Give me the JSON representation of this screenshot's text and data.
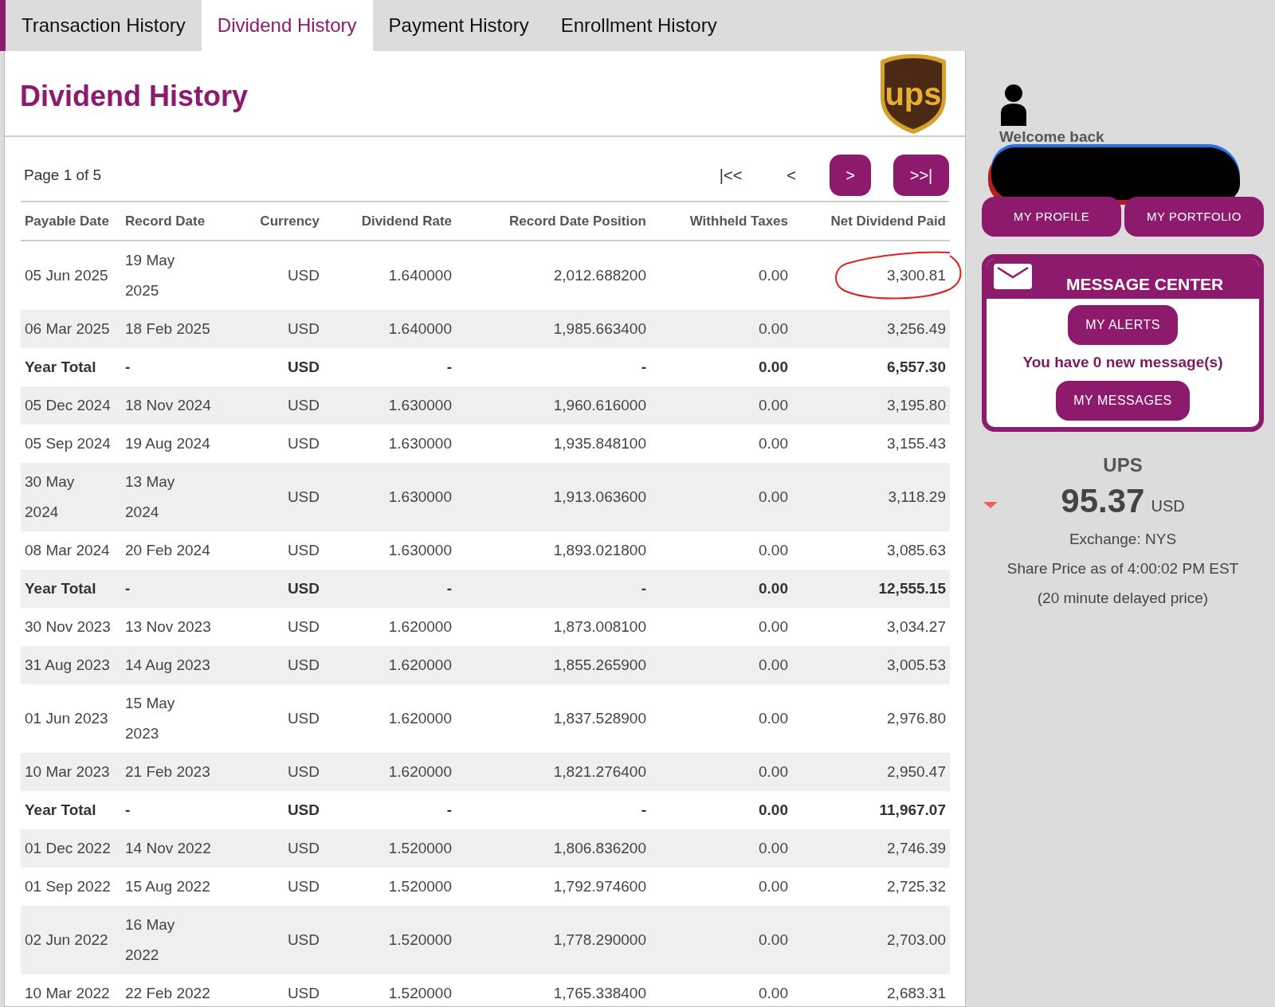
{
  "tabs": [
    {
      "label": "Transaction History",
      "selected": false
    },
    {
      "label": "Dividend History",
      "selected": true
    },
    {
      "label": "Payment History",
      "selected": false
    },
    {
      "label": "Enrollment History",
      "selected": false
    }
  ],
  "panel": {
    "title": "Dividend History",
    "logo_text": "ups"
  },
  "pager": {
    "page_text": "Page 1 of 5",
    "buttons": [
      {
        "label": "|<<",
        "disabled": true
      },
      {
        "label": "<",
        "disabled": true
      },
      {
        "label": ">",
        "disabled": false
      },
      {
        "label": ">>|",
        "disabled": false
      }
    ]
  },
  "table": {
    "columns": [
      "Payable Date",
      "Record Date",
      "Currency",
      "Dividend Rate",
      "Record Date Position",
      "Withheld Taxes",
      "Net Dividend Paid"
    ],
    "rows": [
      {
        "kind": "payment",
        "cells": [
          "05 Jun 2025",
          "19 May 2025",
          "USD",
          "1.640000",
          "2,012.688200",
          "0.00",
          "3,300.81"
        ],
        "annotated": true
      },
      {
        "kind": "payment",
        "cells": [
          "06 Mar 2025",
          "18 Feb 2025",
          "USD",
          "1.640000",
          "1,985.663400",
          "0.00",
          "3,256.49"
        ],
        "annotated": false
      },
      {
        "kind": "total",
        "cells": [
          "Year Total",
          "-",
          "USD",
          "-",
          "-",
          "0.00",
          "6,557.30"
        ],
        "annotated": false
      },
      {
        "kind": "payment",
        "cells": [
          "05 Dec 2024",
          "18 Nov 2024",
          "USD",
          "1.630000",
          "1,960.616000",
          "0.00",
          "3,195.80"
        ],
        "annotated": false
      },
      {
        "kind": "payment",
        "cells": [
          "05 Sep 2024",
          "19 Aug 2024",
          "USD",
          "1.630000",
          "1,935.848100",
          "0.00",
          "3,155.43"
        ],
        "annotated": false
      },
      {
        "kind": "payment",
        "cells": [
          "30 May 2024",
          "13 May 2024",
          "USD",
          "1.630000",
          "1,913.063600",
          "0.00",
          "3,118.29"
        ],
        "annotated": false
      },
      {
        "kind": "payment",
        "cells": [
          "08 Mar 2024",
          "20 Feb 2024",
          "USD",
          "1.630000",
          "1,893.021800",
          "0.00",
          "3,085.63"
        ],
        "annotated": false
      },
      {
        "kind": "total",
        "cells": [
          "Year Total",
          "-",
          "USD",
          "-",
          "-",
          "0.00",
          "12,555.15"
        ],
        "annotated": false
      },
      {
        "kind": "payment",
        "cells": [
          "30 Nov 2023",
          "13 Nov 2023",
          "USD",
          "1.620000",
          "1,873.008100",
          "0.00",
          "3,034.27"
        ],
        "annotated": false
      },
      {
        "kind": "payment",
        "cells": [
          "31 Aug 2023",
          "14 Aug 2023",
          "USD",
          "1.620000",
          "1,855.265900",
          "0.00",
          "3,005.53"
        ],
        "annotated": false
      },
      {
        "kind": "payment",
        "cells": [
          "01 Jun 2023",
          "15 May 2023",
          "USD",
          "1.620000",
          "1,837.528900",
          "0.00",
          "2,976.80"
        ],
        "annotated": false
      },
      {
        "kind": "payment",
        "cells": [
          "10 Mar 2023",
          "21 Feb 2023",
          "USD",
          "1.620000",
          "1,821.276400",
          "0.00",
          "2,950.47"
        ],
        "annotated": false
      },
      {
        "kind": "total",
        "cells": [
          "Year Total",
          "-",
          "USD",
          "-",
          "-",
          "0.00",
          "11,967.07"
        ],
        "annotated": false
      },
      {
        "kind": "payment",
        "cells": [
          "01 Dec 2022",
          "14 Nov 2022",
          "USD",
          "1.520000",
          "1,806.836200",
          "0.00",
          "2,746.39"
        ],
        "annotated": false
      },
      {
        "kind": "payment",
        "cells": [
          "01 Sep 2022",
          "15 Aug 2022",
          "USD",
          "1.520000",
          "1,792.974600",
          "0.00",
          "2,725.32"
        ],
        "annotated": false
      },
      {
        "kind": "payment",
        "cells": [
          "02 Jun 2022",
          "16 May 2022",
          "USD",
          "1.520000",
          "1,778.290000",
          "0.00",
          "2,703.00"
        ],
        "annotated": false
      },
      {
        "kind": "payment",
        "cells": [
          "10 Mar 2022",
          "22 Feb 2022",
          "USD",
          "1.520000",
          "1,765.338400",
          "0.00",
          "2,683.31"
        ],
        "annotated": false
      }
    ]
  },
  "sidebar": {
    "welcome": "Welcome back",
    "name_redacted": true,
    "buttons": [
      "MY PROFILE",
      "MY PORTFOLIO"
    ],
    "message_center": {
      "title": "MESSAGE CENTER",
      "alerts_button": "MY ALERTS",
      "message": "You have 0 new message(s)",
      "messages_button": "MY MESSAGES"
    },
    "quote": {
      "symbol": "UPS",
      "price_falling": true,
      "price": "95.37",
      "currency": "USD",
      "exchange": "Exchange: NYS",
      "as_of": "Share Price as of 4:00:02 PM EST",
      "note": "(20 minute delayed price)"
    }
  }
}
